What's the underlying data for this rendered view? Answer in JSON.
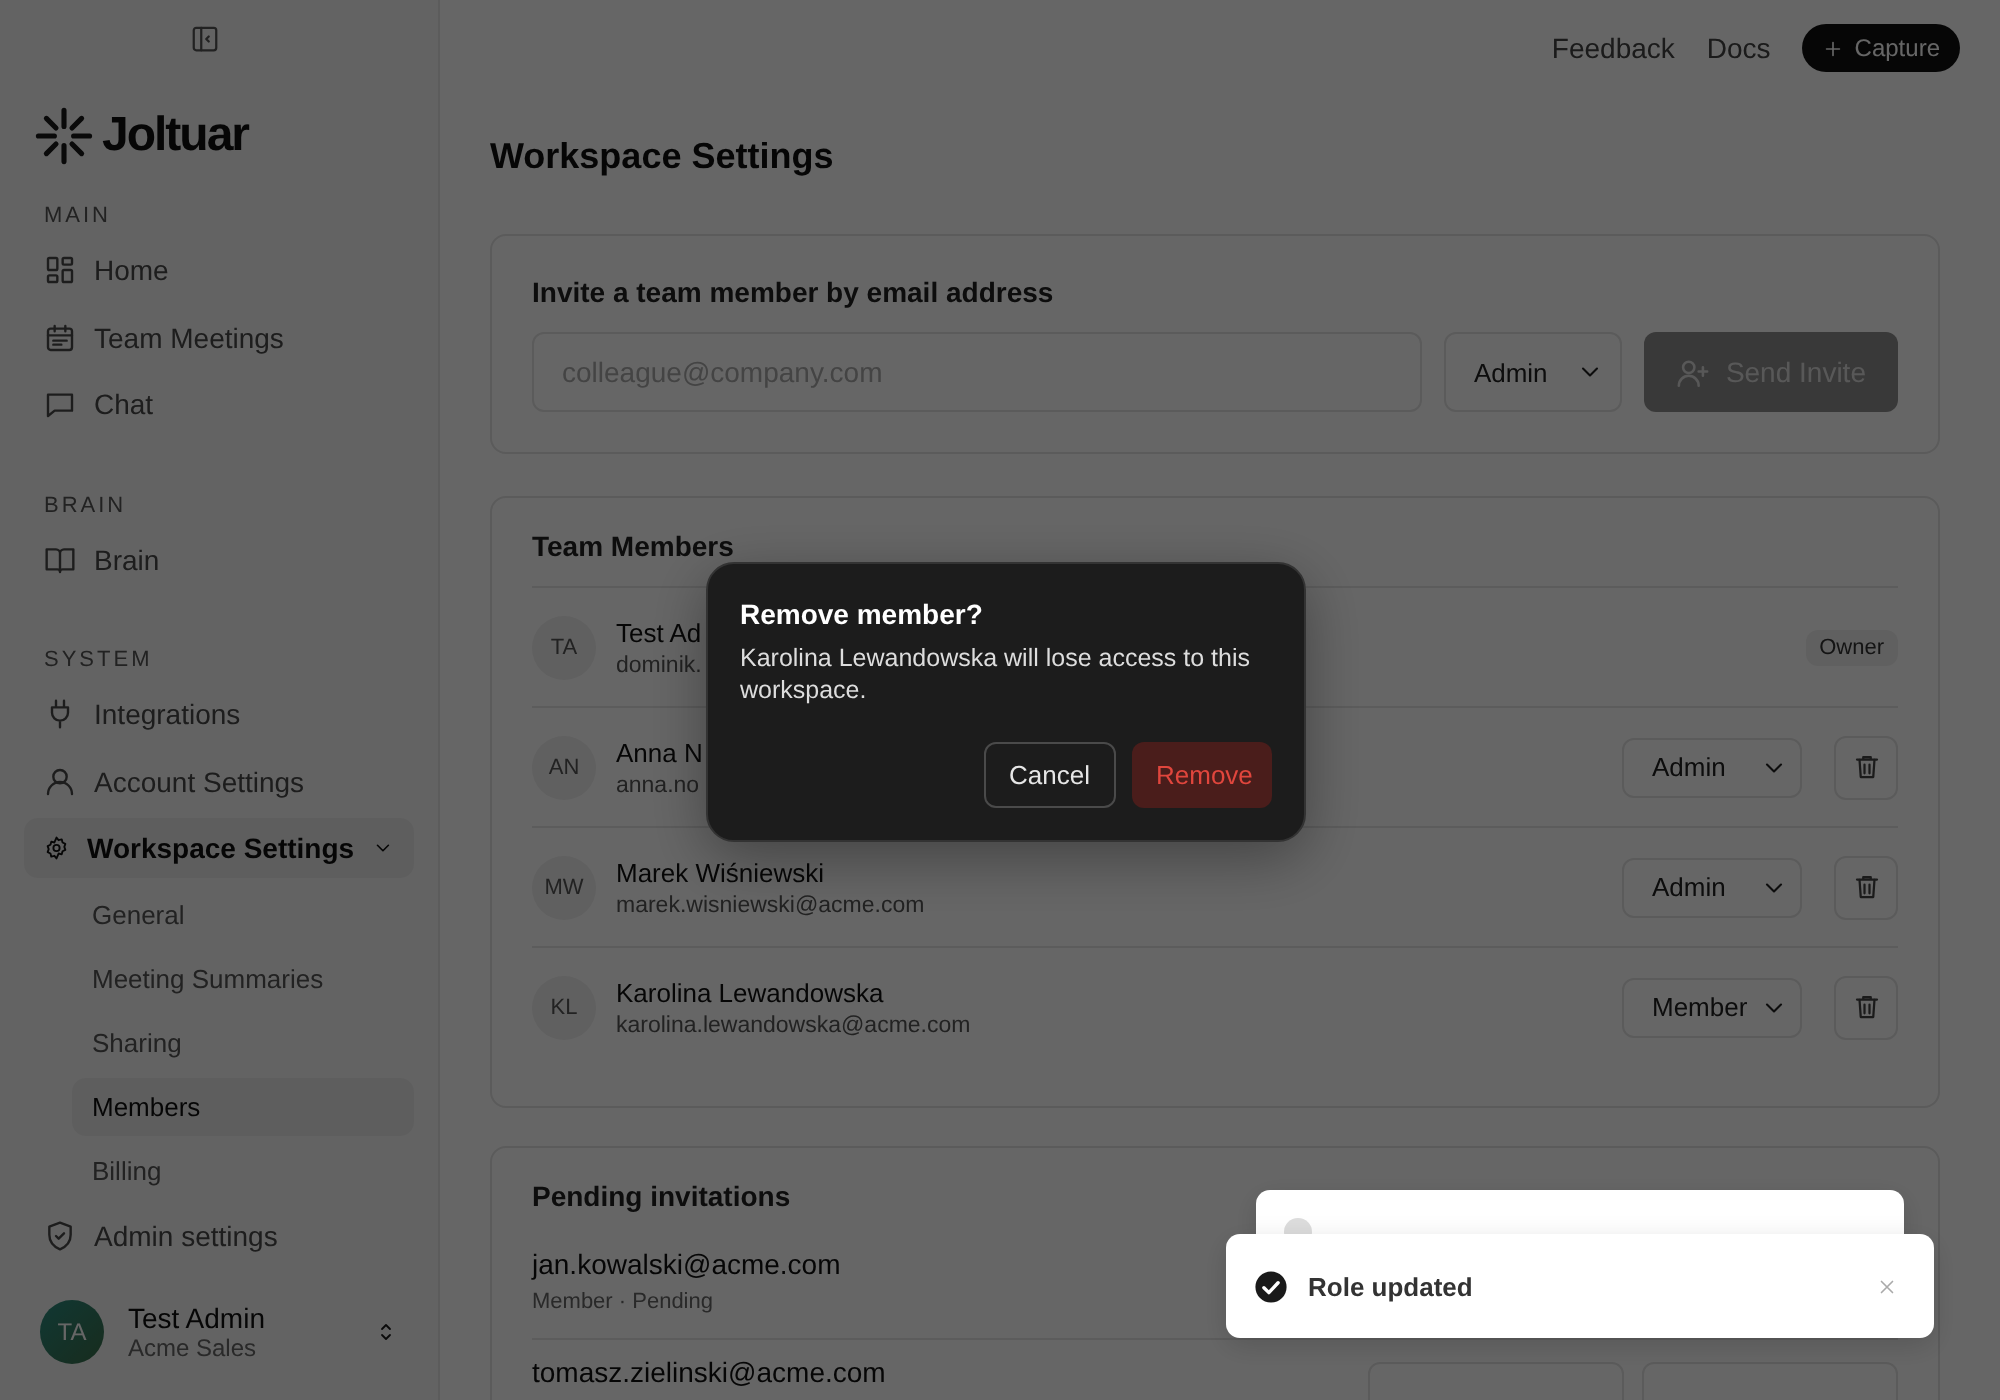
{
  "sidebar": {
    "logo": "Joltuar",
    "sections": [
      {
        "heading": "MAIN",
        "items": [
          {
            "label": "Home",
            "selected": false
          },
          {
            "label": "Team Meetings",
            "selected": false
          },
          {
            "label": "Chat",
            "selected": false
          }
        ]
      },
      {
        "heading": "BRAIN",
        "items": [
          {
            "label": "Brain",
            "selected": false
          }
        ]
      },
      {
        "heading": "SYSTEM",
        "items": [
          {
            "label": "Integrations",
            "selected": false
          },
          {
            "label": "Account Settings",
            "selected": false
          },
          {
            "label": "Workspace Settings",
            "selected": true,
            "expanded": true,
            "children": [
              {
                "label": "General",
                "selected": false
              },
              {
                "label": "Meeting Summaries",
                "selected": false
              },
              {
                "label": "Sharing",
                "selected": false
              },
              {
                "label": "Members",
                "selected": true
              },
              {
                "label": "Billing",
                "selected": false
              }
            ]
          },
          {
            "label": "Admin settings",
            "selected": false
          }
        ]
      }
    ],
    "user": {
      "initials": "TA",
      "name": "Test Admin",
      "org": "Acme Sales"
    }
  },
  "topbar": {
    "links": [
      "Feedback",
      "Docs"
    ],
    "capture": "Capture"
  },
  "page_title": "Workspace Settings",
  "invite": {
    "heading": "Invite a team member by email address",
    "email": {
      "placeholder": "colleague@company.com"
    },
    "role": "Admin",
    "send_button": {
      "label": "Send Invite",
      "disabled": true
    }
  },
  "team_members": {
    "heading": "Team Members",
    "members": [
      {
        "initials": "TA",
        "name": "Test Ad",
        "email": "dominik.",
        "kind": "owner",
        "badge": "Owner"
      },
      {
        "initials": "AN",
        "name": "Anna N",
        "email": "anna.no",
        "kind": "editable",
        "role": "Admin"
      },
      {
        "initials": "MW",
        "name": "Marek Wiśniewski",
        "email": "marek.wisniewski@acme.com",
        "kind": "editable",
        "role": "Admin"
      },
      {
        "initials": "KL",
        "name": "Karolina Lewandowska",
        "email": "karolina.lewandowska@acme.com",
        "kind": "editable",
        "role": "Member"
      }
    ]
  },
  "pending": {
    "heading": "Pending invitations",
    "invites": [
      {
        "email": "jan.kowalski@acme.com",
        "meta": "Member · Pending"
      },
      {
        "email": "tomasz.zielinski@acme.com",
        "kind": "with_actions"
      }
    ]
  },
  "dialog": {
    "title": "Remove member?",
    "message": "Karolina Lewandowska will lose access to this workspace.",
    "cancel": "Cancel",
    "confirm": "Remove"
  },
  "toasts": [
    {
      "kind": "behind"
    },
    {
      "kind": "front",
      "text": "Role updated"
    }
  ]
}
